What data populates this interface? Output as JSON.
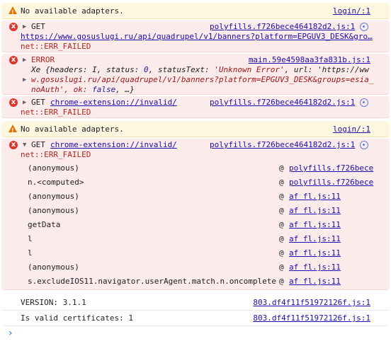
{
  "warn1": {
    "text": "No available adapters.",
    "source": "login/:1"
  },
  "err1": {
    "method": "GET",
    "source": "polyfills.f726bece464182d2.js:1",
    "url": "https://www.gosuslugi.ru/api/quadrupel/v1/banners?platform=EPGUV3_DESK&gro…",
    "status": "net::ERR_FAILED"
  },
  "err2": {
    "label": "ERROR",
    "source": "main.59e4598aa3fa831b.js:1",
    "obj_line1_prefix": "Xe {headers: I, status: ",
    "obj_status": "0",
    "obj_line1_mid": ", statusText: ",
    "obj_statusText": "'Unknown Error'",
    "obj_line1_end": ", url: 'https://ww",
    "obj_line2": "w.gosuslugi.ru/api/quadrupel/v1/banners?platform=EPGUV3_DESK&groups=esia_",
    "obj_line3_prefix": "noAuth', ok: ",
    "obj_ok": "false",
    "obj_line3_end": ", …}"
  },
  "err3": {
    "method": "GET",
    "url": "chrome-extension://invalid/",
    "source": "polyfills.f726bece464182d2.js:1",
    "status": "net::ERR_FAILED"
  },
  "warn2": {
    "text": "No available adapters.",
    "source": "login/:1"
  },
  "err4": {
    "method": "GET",
    "url": "chrome-extension://invalid/",
    "source": "polyfills.f726bece464182d2.js:1",
    "status": "net::ERR_FAILED",
    "stack": [
      {
        "fn": "(anonymous)",
        "at": "@",
        "loc": "polyfills.f726bece"
      },
      {
        "fn": "n.<computed>",
        "at": "@",
        "loc": "polyfills.f726bece"
      },
      {
        "fn": "(anonymous)",
        "at": "@",
        "loc": "af fl.js:11"
      },
      {
        "fn": "(anonymous)",
        "at": "@",
        "loc": "af fl.js:11"
      },
      {
        "fn": "getData",
        "at": "@",
        "loc": "af fl.js:11"
      },
      {
        "fn": "l",
        "at": "@",
        "loc": "af fl.js:11"
      },
      {
        "fn": "l",
        "at": "@",
        "loc": "af fl.js:11"
      },
      {
        "fn": "(anonymous)",
        "at": "@",
        "loc": "af fl.js:11"
      },
      {
        "fn": "s.excludeIOS11.navigator.userAgent.match.n.oncomplete",
        "at": "@",
        "loc": "af fl.js:11"
      }
    ]
  },
  "log1": {
    "text": "VERSION: 3.1.1",
    "source": "803.df4f11f51972126f.js:1"
  },
  "log2": {
    "text": "Is valid certificates: 1",
    "source": "803.df4f11f51972126f.js:1"
  },
  "prompt": {
    "glyph": "›"
  },
  "icons": {
    "error": "x",
    "warning": "!",
    "expand": "▶",
    "collapse": "▼"
  },
  "colors": {
    "error_bg": "#fcebeb",
    "warn_bg": "#fef7e0",
    "link": "#1a0dab",
    "error_text": "#b3261e"
  }
}
